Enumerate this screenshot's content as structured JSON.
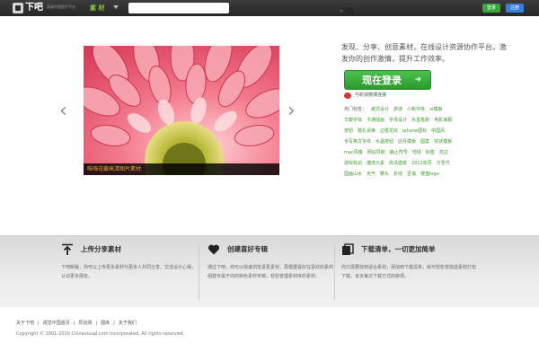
{
  "topbar": {
    "logo_text": "下吧",
    "logo_sub": "高端中国图片平台",
    "category_label": "素 材",
    "search_placeholder": "",
    "login_label": "登录",
    "register_label": "注册",
    "accent_green": "#7fd13b"
  },
  "carousel": {
    "caption": "唯嗨花瓣高清图片素材",
    "prev_label": "‹",
    "next_label": "›"
  },
  "panel": {
    "tagline": "发现、分享、创意素材，在线设计资源协作平台。激发你的创作激情，提升工作效率。",
    "login_label": "现在登录",
    "login_arrow": "➜",
    "weibo_label": "与新浪微博连接",
    "tags_title": "热门标签：",
    "tags": [
      "装式设计",
      "旅游",
      "小新字体",
      "vi模板",
      "华康字体",
      "卡通插画",
      "字母设计",
      "水墨笔刷",
      "电影海报",
      "按钮",
      "婚礼请柬",
      "边框花纹",
      "iphone图标",
      "中国风",
      "手写英文字体",
      "水晶按钮",
      "店月模板",
      "图案",
      "奖状模板",
      "mac风格",
      "网站导航",
      "静止符号",
      "地球",
      "标签",
      "花边",
      "游戏标识",
      "潮流元素",
      "高清壁纸",
      "2011年历",
      "万圣节",
      "国画山水",
      "天气",
      "鞭头",
      "折线",
      "圣诞",
      "楼盘logo"
    ]
  },
  "features": [
    {
      "icon": "upload-icon",
      "title": "上传分享素材",
      "text": "下吧新版，你可以上传更多素材与更多人共同分享，交流设计心得，认识更多朋友。"
    },
    {
      "icon": "heart-icon",
      "title": "创建喜好专辑",
      "text": "通过下吧，你可以快速浏览喜爱素材，再根据喜好在喜欢的素材组建专属于你的特色素材专辑，轻松管理素材库的素材。"
    },
    {
      "icon": "download-list-icon",
      "title": "下载清单，一切更加简单",
      "text": "你只需要找到适合素材，添加到下载清单，就可轻松将找选素材打包下载，省去每次下载方式的麻烦。"
    }
  ],
  "footer": {
    "links": [
      "关于下吧",
      "|",
      "视觉中国首页",
      "|",
      "原创网",
      "|",
      "图库",
      "|",
      "关于我们"
    ],
    "copyright": "Copyright © 2001-2010 Chinavisual.com Incorporated. All rights reserved."
  }
}
